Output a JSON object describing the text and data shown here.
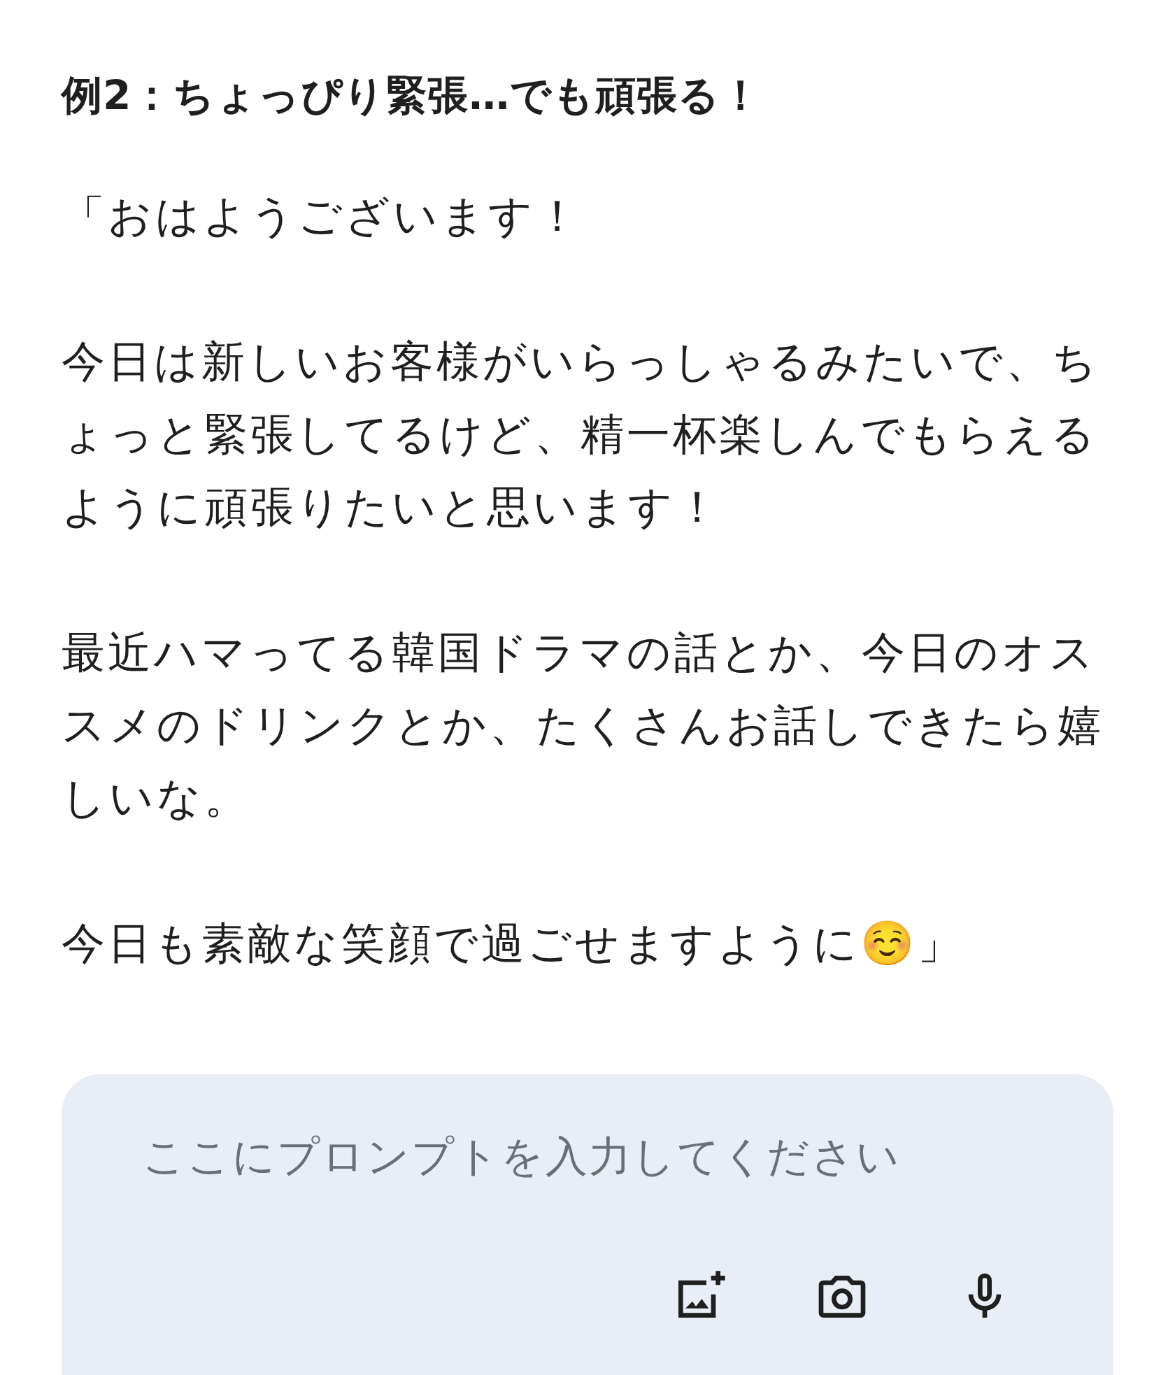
{
  "heading": "例2：ちょっぴり緊張…でも頑張る！",
  "paragraphs": [
    "「おはようございます！",
    "今日は新しいお客様がいらっしゃるみたいで、ちょっと緊張してるけど、精一杯楽しんでもらえるように頑張りたいと思います！",
    "最近ハマってる韓国ドラマの話とか、今日のオススメのドリンクとか、たくさんお話しできたら嬉しいな。",
    "今日も素敵な笑顔で過ごせますように☺️」"
  ],
  "prompt": {
    "placeholder": "ここにプロンプトを入力してください"
  }
}
